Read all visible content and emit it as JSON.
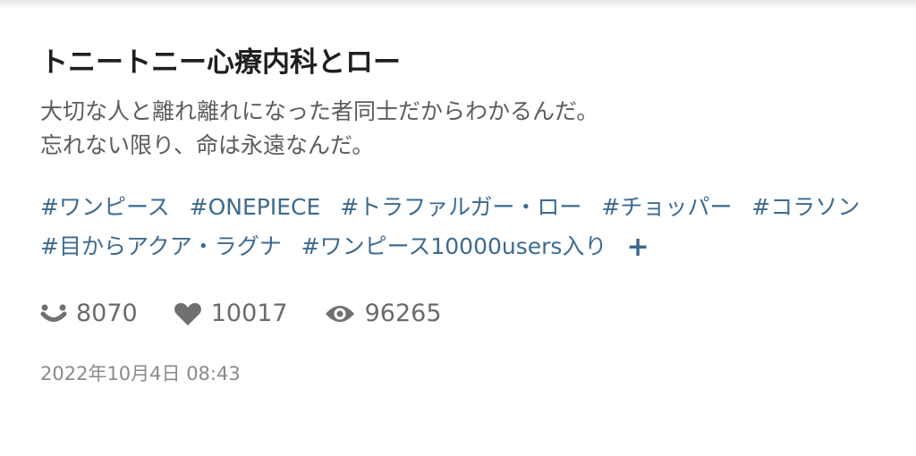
{
  "post": {
    "title": "トニートニー心療内科とロー",
    "description_lines": [
      "大切な人と離れ離れになった者同士だからわかるんだ。",
      "忘れない限り、命は永遠なんだ。"
    ],
    "tags": [
      "#ワンピース",
      "#ONEPIECE",
      "#トラファルガー・ロー",
      "#チョッパー",
      "#コラソン",
      "#目からアクア・ラグナ",
      "#ワンピース10000users入り"
    ],
    "add_tag_label": "+",
    "stats": {
      "reactions": "8070",
      "likes": "10017",
      "views": "96265"
    },
    "date": "2022年10月4日 08:43"
  },
  "icons": {
    "reactions": "smile-reaction-icon",
    "likes": "heart-icon",
    "views": "eye-icon"
  },
  "colors": {
    "tag": "#3d6a8e",
    "stat_icon": "#707070"
  }
}
